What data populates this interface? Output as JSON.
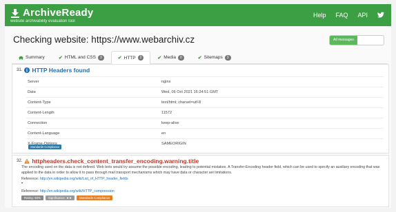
{
  "app": {
    "title": "ArchiveReady",
    "tagline": "website archivability evaluation tool",
    "brand_color": "#3d9f43"
  },
  "nav": {
    "items": [
      "Help",
      "FAQ",
      "API"
    ],
    "twitter_icon": "twitter-icon"
  },
  "page": {
    "title": "Checking website: https://www.webarchiv.cz",
    "all_messages_label": "All messages"
  },
  "tabs": [
    {
      "label": "Summary",
      "badge": "",
      "active": false
    },
    {
      "label": "HTML and CSS",
      "badge": "3",
      "active": false
    },
    {
      "label": "HTTP",
      "badge": "2",
      "active": true
    },
    {
      "label": "Media",
      "badge": "0",
      "active": false
    },
    {
      "label": "Sitemaps",
      "badge": "3",
      "active": false
    }
  ],
  "section31": {
    "number": "31.",
    "title": "HTTP Headers found",
    "headers": [
      [
        "Server",
        "nginx"
      ],
      [
        "Date",
        "Wed, 06 Oct 2021 16:24:51 GMT"
      ],
      [
        "Content-Type",
        "text/html; charset=utf-8"
      ],
      [
        "Content-Length",
        "11572"
      ],
      [
        "Connection",
        "keep-alive"
      ],
      [
        "Content-Language",
        "en"
      ],
      [
        "X-Frame-Options",
        "SAMEORIGIN"
      ]
    ],
    "badge": "Standards Compliance"
  },
  "section32": {
    "number": "32.",
    "title": "httpheaders.check_content_transfer_encoding.warning.title",
    "description": "The encoding used on the data is not defined. Web bots would try assume the possible encoding, leading to potential mistakes. A Transfer-Encoding header field, which can be used to specify an auxiliary encoding that was applied to the data in order to allow it to pass through mail transport mechanisms which may have data or character set limitations.",
    "ref_label": "Reference:",
    "ref1_url": "http://en.wikipedia.org/wiki/List_of_HTTP_header_fields",
    "dot": "•",
    "ref2_url": "http://en.wikipedia.org/wiki/HTTP_compression",
    "pill_rating": "Rating: 50%",
    "pill_significance": "Significance: ★★",
    "pill_standards": "Standards Compliance"
  }
}
